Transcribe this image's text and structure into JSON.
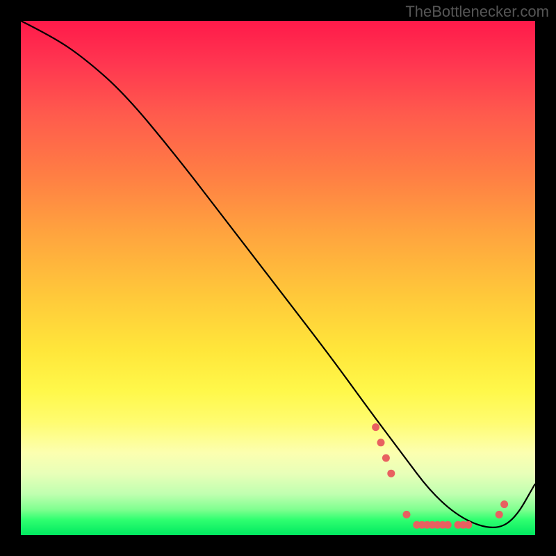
{
  "watermark": "TheBottlenecker.com",
  "chart_data": {
    "type": "line",
    "title": "",
    "xlabel": "",
    "ylabel": "",
    "xlim": [
      0,
      100
    ],
    "ylim": [
      0,
      100
    ],
    "series": [
      {
        "name": "curve",
        "x": [
          0,
          6,
          12,
          20,
          30,
          40,
          50,
          60,
          68,
          74,
          80,
          86,
          92,
          96,
          100
        ],
        "y": [
          100,
          97,
          93,
          86,
          74,
          61,
          48,
          35,
          24,
          16,
          8,
          3,
          1,
          3,
          10
        ]
      }
    ],
    "markers": {
      "name": "highlight-points",
      "color": "#e86060",
      "x": [
        69,
        70,
        71,
        72,
        75,
        77,
        78,
        79,
        80,
        81,
        82,
        83,
        85,
        86,
        87,
        93,
        94
      ],
      "y": [
        21,
        18,
        15,
        12,
        4,
        2,
        2,
        2,
        2,
        2,
        2,
        2,
        2,
        2,
        2,
        4,
        6
      ]
    }
  }
}
